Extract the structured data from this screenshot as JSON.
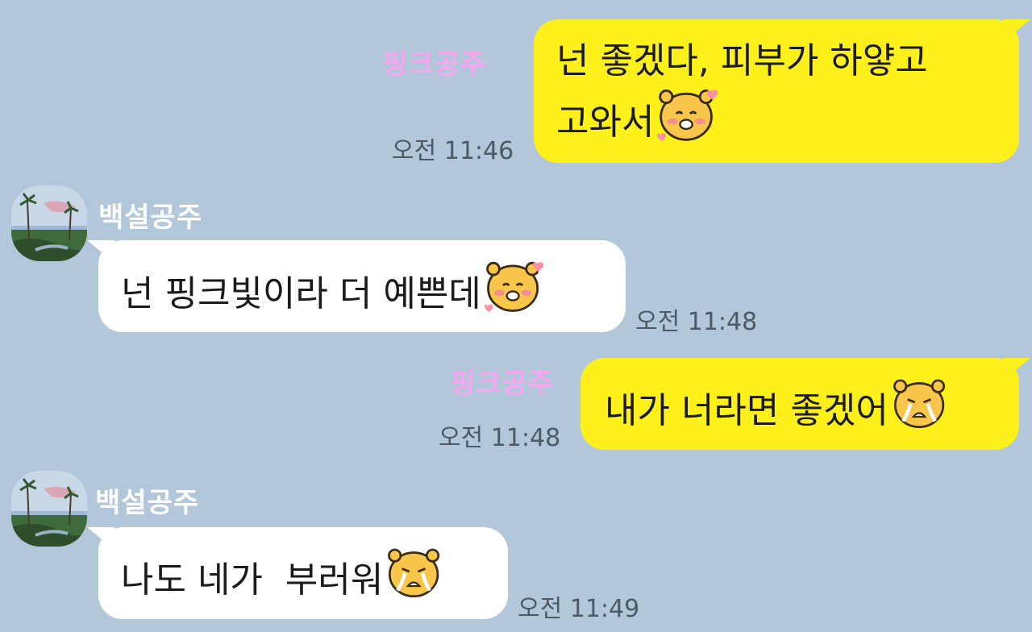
{
  "messages": [
    {
      "sender": "핑크공주",
      "side": "right",
      "lines": [
        "넌 좋겠다, 피부가 하얗고",
        "고와서"
      ],
      "emoji": "blushing-bear-emoticon",
      "time": "오전 11:46"
    },
    {
      "sender": "백설공주",
      "side": "left",
      "lines": [
        "넌 핑크빛이라 더 예쁜데"
      ],
      "emoji": "blushing-bear-emoticon",
      "time": "오전 11:48"
    },
    {
      "sender": "핑크공주",
      "side": "right",
      "lines": [
        "내가 너라면 좋겠어"
      ],
      "emoji": "crying-bear-emoticon",
      "time": "오전 11:48"
    },
    {
      "sender": "백설공주",
      "side": "left",
      "lines": [
        "나도 네가  부러워"
      ],
      "emoji": "crying-bear-emoticon",
      "time": "오전 11:49"
    }
  ],
  "colors": {
    "background": "#b2c7d9",
    "my_bubble": "#fef01b",
    "their_bubble": "#ffffff",
    "pink_name": "#f7a6f0",
    "white_name": "#ffffff",
    "timestamp": "#4d5a66"
  }
}
